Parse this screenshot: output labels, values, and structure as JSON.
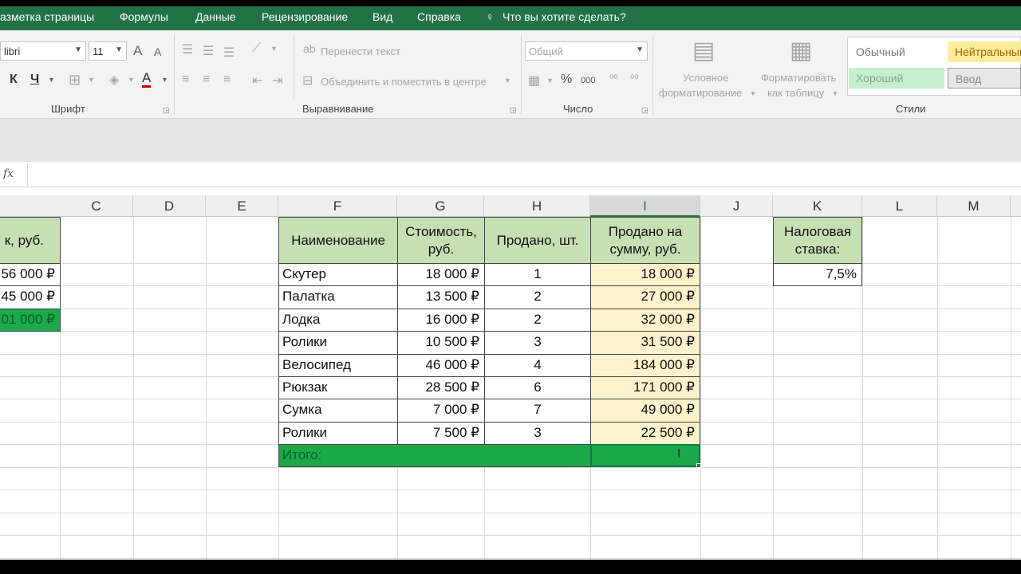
{
  "ribbon_tabs": [
    "азметка страницы",
    "Формулы",
    "Данные",
    "Рецензирование",
    "Вид",
    "Справка",
    "Что вы хотите сделать?"
  ],
  "font_group": {
    "font_name": "libri",
    "font_size": "11",
    "label": "Шрифт",
    "bold": "К",
    "underline": "Ч",
    "grow_font": "A",
    "shrink_font": "A",
    "font_color": "A"
  },
  "alignment_group": {
    "wrap_text": "Перенести текст",
    "merge_center": "Объединить и поместить в центре",
    "label": "Выравнивание"
  },
  "number_group": {
    "format": "Общий",
    "percent": "%",
    "thousands": "000",
    "label": "Число"
  },
  "styles_group": {
    "conditional_formatting": [
      "Условное",
      "форматирование"
    ],
    "format_as_table": [
      "Форматировать",
      "как таблицу"
    ],
    "styles": [
      "Обычный",
      "Нейтральный",
      "Хороший",
      "Ввод"
    ],
    "label": "Стили"
  },
  "formula_bar": {
    "fx": "fx",
    "content": ""
  },
  "columns": [
    "C",
    "D",
    "E",
    "F",
    "G",
    "H",
    "I",
    "J",
    "K",
    "L",
    "M"
  ],
  "selected_column": "I",
  "left_partial": {
    "header": "к, руб.",
    "values": [
      "56 000 ₽",
      "45 000 ₽",
      "01 000 ₽"
    ]
  },
  "table": {
    "headers": {
      "name": "Наименование",
      "cost": [
        "Стоимость,",
        "руб."
      ],
      "sold": "Продано, шт.",
      "sold_sum": [
        "Продано на",
        "сумму, руб."
      ]
    },
    "rows": [
      {
        "name": "Скутер",
        "cost": "18 000 ₽",
        "qty": "1",
        "sum": "18 000 ₽"
      },
      {
        "name": "Палатка",
        "cost": "13 500 ₽",
        "qty": "2",
        "sum": "27 000 ₽"
      },
      {
        "name": "Лодка",
        "cost": "16 000 ₽",
        "qty": "2",
        "sum": "32 000 ₽"
      },
      {
        "name": "Ролики",
        "cost": "10 500 ₽",
        "qty": "3",
        "sum": "31 500 ₽"
      },
      {
        "name": "Велосипед",
        "cost": "46 000 ₽",
        "qty": "4",
        "sum": "184 000 ₽"
      },
      {
        "name": "Рюкзак",
        "cost": "28 500 ₽",
        "qty": "6",
        "sum": "171 000 ₽"
      },
      {
        "name": "Сумка",
        "cost": "7 000 ₽",
        "qty": "7",
        "sum": "49 000 ₽"
      },
      {
        "name": "Ролики",
        "cost": "7 500 ₽",
        "qty": "3",
        "sum": "22 500 ₽"
      }
    ],
    "total_label": "Итого:"
  },
  "tax": {
    "label": [
      "Налоговая",
      "ставка:"
    ],
    "value": "7,5%"
  },
  "colors": {
    "accent_green": "#217346",
    "header_fill": "#c6e0b4",
    "highlight_fill": "#fff2cc",
    "total_fill": "#1aa84b"
  }
}
